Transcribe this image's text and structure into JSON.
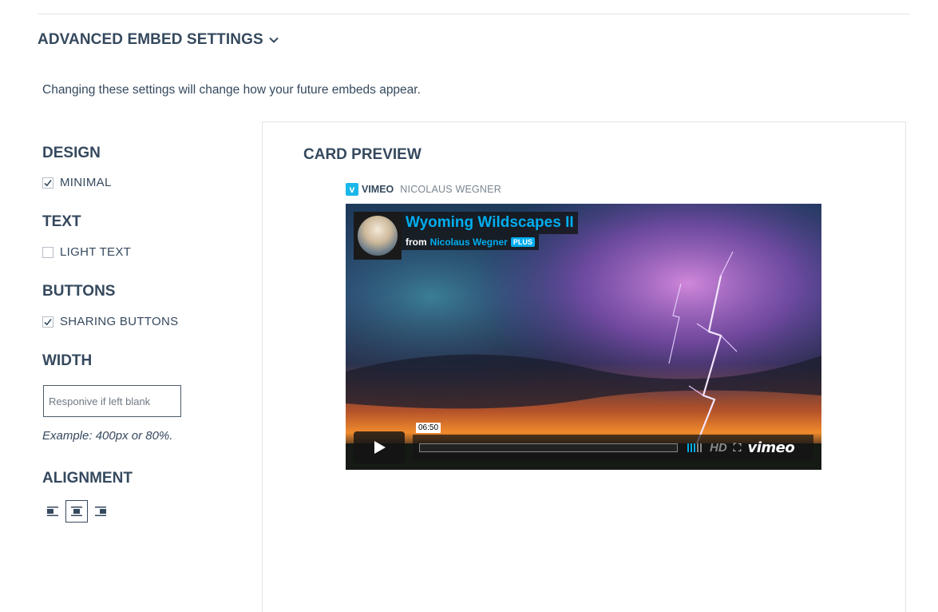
{
  "section": {
    "title": "ADVANCED EMBED SETTINGS",
    "description": "Changing these settings will change how your future embeds appear."
  },
  "design": {
    "title": "DESIGN",
    "option_label": "MINIMAL",
    "checked": true
  },
  "text": {
    "title": "TEXT",
    "option_label": "LIGHT TEXT",
    "checked": false
  },
  "buttons": {
    "title": "BUTTONS",
    "option_label": "SHARING BUTTONS",
    "checked": true
  },
  "width": {
    "title": "WIDTH",
    "placeholder": "Responive if left blank",
    "value": "",
    "example": "Example: 400px or 80%."
  },
  "alignment": {
    "title": "ALIGNMENT",
    "options": [
      "left",
      "center",
      "right"
    ],
    "selected": "center"
  },
  "preview": {
    "title": "CARD PREVIEW",
    "site": "VIMEO",
    "site_icon": "vimeo-v-icon",
    "author": "NICOLAUS WEGNER",
    "video": {
      "title": "Wyoming Wildscapes II",
      "from_label": "from",
      "author": "Nicolaus Wegner",
      "badge": "PLUS",
      "time": "06:50",
      "quality": "HD",
      "brand": "vimeo"
    }
  },
  "colors": {
    "heading": "#35495e",
    "vimeo_blue": "#00adef",
    "border": "#e1e5e8"
  }
}
